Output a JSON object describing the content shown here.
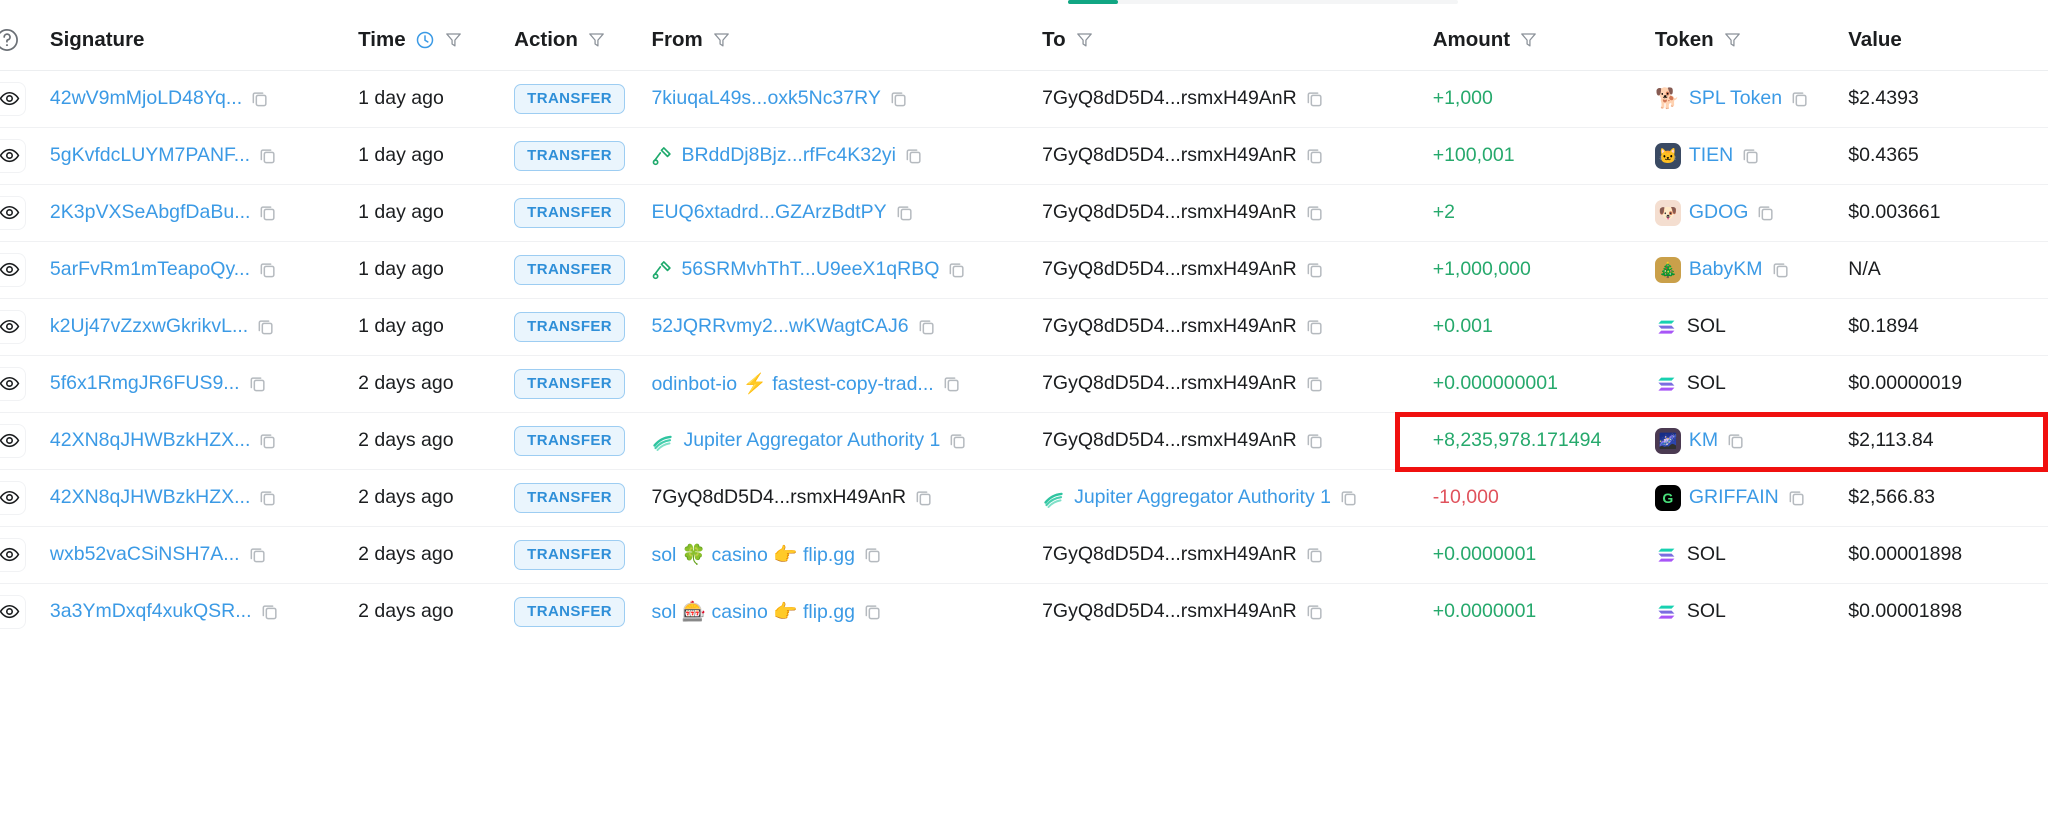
{
  "topbar": {
    "scroll_thumb_color": "#11a683"
  },
  "table": {
    "headers": {
      "help": "?",
      "signature": "Signature",
      "time": "Time",
      "action": "Action",
      "from": "From",
      "to": "To",
      "amount": "Amount",
      "token": "Token",
      "value": "Value"
    },
    "icons": {
      "help": "help-circle-icon",
      "clock": "clock-icon",
      "filter": "filter-icon",
      "copy": "copy-icon",
      "eye": "eye-icon"
    },
    "rows": [
      {
        "signature": "42wV9mMjoLD48Yq...",
        "time": "1 day ago",
        "action": "TRANSFER",
        "from": {
          "label": "7kiuqaL49s...oxk5Nc37RY",
          "link": true,
          "icon": "",
          "icon_type": "none"
        },
        "to": {
          "label": "7GyQ8dD5D4...rsmxH49AnR",
          "link": false,
          "icon": "",
          "icon_type": "none"
        },
        "amount": "+1,000",
        "amount_sign": "positive",
        "token": {
          "symbol": "SPL Token",
          "icon": "🐕",
          "icon_type": "emoji",
          "copyable": true
        },
        "value": "$2.4393"
      },
      {
        "signature": "5gKvfdcLUYM7PANF...",
        "time": "1 day ago",
        "action": "TRANSFER",
        "from": {
          "label": "BRddDj8Bjz...rfFc4K32yi",
          "link": true,
          "icon": "verified-program-icon",
          "icon_type": "program"
        },
        "to": {
          "label": "7GyQ8dD5D4...rsmxH49AnR",
          "link": false,
          "icon": "",
          "icon_type": "none"
        },
        "amount": "+100,001",
        "amount_sign": "positive",
        "token": {
          "symbol": "TIEN",
          "icon": "🐱",
          "icon_type": "image",
          "icon_bg": "#3a4a63",
          "copyable": true
        },
        "value": "$0.4365"
      },
      {
        "signature": "2K3pVXSeAbgfDaBu...",
        "time": "1 day ago",
        "action": "TRANSFER",
        "from": {
          "label": "EUQ6xtadrd...GZArzBdtPY",
          "link": true,
          "icon": "",
          "icon_type": "none"
        },
        "to": {
          "label": "7GyQ8dD5D4...rsmxH49AnR",
          "link": false,
          "icon": "",
          "icon_type": "none"
        },
        "amount": "+2",
        "amount_sign": "positive",
        "token": {
          "symbol": "GDOG",
          "icon": "🐶",
          "icon_type": "image",
          "icon_bg": "#f4ded0",
          "copyable": true
        },
        "value": "$0.003661"
      },
      {
        "signature": "5arFvRm1mTeapoQy...",
        "time": "1 day ago",
        "action": "TRANSFER",
        "from": {
          "label": "56SRMvhThT...U9eeX1qRBQ",
          "link": true,
          "icon": "verified-program-icon",
          "icon_type": "program"
        },
        "to": {
          "label": "7GyQ8dD5D4...rsmxH49AnR",
          "link": false,
          "icon": "",
          "icon_type": "none"
        },
        "amount": "+1,000,000",
        "amount_sign": "positive",
        "token": {
          "symbol": "BabyKM",
          "icon": "🎄",
          "icon_type": "image",
          "icon_bg": "#caa04a",
          "copyable": true
        },
        "value": "N/A"
      },
      {
        "signature": "k2Uj47vZzxwGkrikvL...",
        "time": "1 day ago",
        "action": "TRANSFER",
        "from": {
          "label": "52JQRRvmy2...wKWagtCAJ6",
          "link": true,
          "icon": "",
          "icon_type": "none"
        },
        "to": {
          "label": "7GyQ8dD5D4...rsmxH49AnR",
          "link": false,
          "icon": "",
          "icon_type": "none"
        },
        "amount": "+0.001",
        "amount_sign": "positive",
        "token": {
          "symbol": "SOL",
          "icon": "solana-logo",
          "icon_type": "sol",
          "copyable": false
        },
        "value": "$0.1894"
      },
      {
        "signature": "5f6x1RmgJR6FUS9...",
        "time": "2 days ago",
        "action": "TRANSFER",
        "from": {
          "label": "odinbot-io ⚡ fastest-copy-trad...",
          "link": true,
          "icon": "",
          "icon_type": "none"
        },
        "to": {
          "label": "7GyQ8dD5D4...rsmxH49AnR",
          "link": false,
          "icon": "",
          "icon_type": "none"
        },
        "amount": "+0.000000001",
        "amount_sign": "positive",
        "token": {
          "symbol": "SOL",
          "icon": "solana-logo",
          "icon_type": "sol",
          "copyable": false
        },
        "value": "$0.00000019"
      },
      {
        "signature": "42XN8qJHWBzkHZX...",
        "time": "2 days ago",
        "action": "TRANSFER",
        "from": {
          "label": "Jupiter Aggregator Authority 1",
          "link": true,
          "icon": "jupiter-icon",
          "icon_type": "jupiter"
        },
        "to": {
          "label": "7GyQ8dD5D4...rsmxH49AnR",
          "link": false,
          "icon": "",
          "icon_type": "none"
        },
        "amount": "+8,235,978.171494",
        "amount_sign": "positive",
        "token": {
          "symbol": "KM",
          "icon": "🌌",
          "icon_type": "image",
          "icon_bg": "#4b3a52",
          "copyable": true
        },
        "value": "$2,113.84",
        "highlighted": true
      },
      {
        "signature": "42XN8qJHWBzkHZX...",
        "time": "2 days ago",
        "action": "TRANSFER",
        "from": {
          "label": "7GyQ8dD5D4...rsmxH49AnR",
          "link": false,
          "icon": "",
          "icon_type": "none"
        },
        "to": {
          "label": "Jupiter Aggregator Authority 1",
          "link": true,
          "icon": "jupiter-icon",
          "icon_type": "jupiter"
        },
        "amount": "-10,000",
        "amount_sign": "negative",
        "token": {
          "symbol": "GRIFFAIN",
          "icon": "G",
          "icon_type": "letter",
          "icon_bg": "#000000",
          "copyable": true
        },
        "value": "$2,566.83"
      },
      {
        "signature": "wxb52vaCSiNSH7A...",
        "time": "2 days ago",
        "action": "TRANSFER",
        "from": {
          "label": "sol 🍀 casino 👉 flip.gg",
          "link": true,
          "icon": "",
          "icon_type": "none"
        },
        "to": {
          "label": "7GyQ8dD5D4...rsmxH49AnR",
          "link": false,
          "icon": "",
          "icon_type": "none"
        },
        "amount": "+0.0000001",
        "amount_sign": "positive",
        "token": {
          "symbol": "SOL",
          "icon": "solana-logo",
          "icon_type": "sol",
          "copyable": false
        },
        "value": "$0.00001898"
      },
      {
        "signature": "3a3YmDxqf4xukQSR...",
        "time": "2 days ago",
        "action": "TRANSFER",
        "from": {
          "label": "sol 🎰 casino 👉 flip.gg",
          "link": true,
          "icon": "",
          "icon_type": "none"
        },
        "to": {
          "label": "7GyQ8dD5D4...rsmxH49AnR",
          "link": false,
          "icon": "",
          "icon_type": "none"
        },
        "amount": "+0.0000001",
        "amount_sign": "positive",
        "token": {
          "symbol": "SOL",
          "icon": "solana-logo",
          "icon_type": "sol",
          "copyable": false
        },
        "value": "$0.00001898"
      }
    ]
  },
  "colors": {
    "link": "#3b9ae5",
    "positive": "#26a96c",
    "negative": "#e0525c",
    "badge_text": "#2f8fd8",
    "badge_bg": "#eaf5fd",
    "highlight": "#f0100f"
  }
}
